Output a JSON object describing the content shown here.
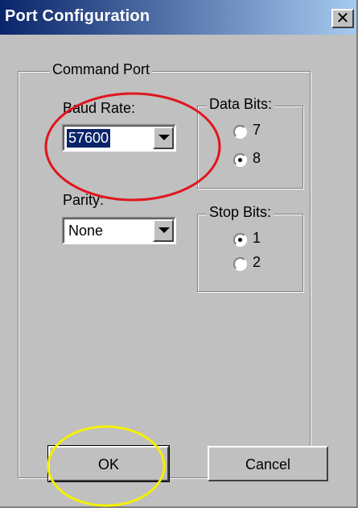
{
  "window": {
    "title": "Port Configuration",
    "close_glyph": "x"
  },
  "command_port": {
    "label": "Command Port",
    "baud_rate": {
      "label": "Baud Rate:",
      "value": "57600"
    },
    "parity": {
      "label": "Parity:",
      "value": "None"
    },
    "data_bits": {
      "label": "Data Bits:",
      "options": [
        {
          "label": "7",
          "checked": false
        },
        {
          "label": "8",
          "checked": true
        }
      ]
    },
    "stop_bits": {
      "label": "Stop Bits:",
      "options": [
        {
          "label": "1",
          "checked": true
        },
        {
          "label": "2",
          "checked": false
        }
      ]
    }
  },
  "buttons": {
    "ok": "OK",
    "cancel": "Cancel"
  },
  "annotations": {
    "red_circle_color": "#e0161e",
    "yellow_circle_color": "#f5f000"
  }
}
